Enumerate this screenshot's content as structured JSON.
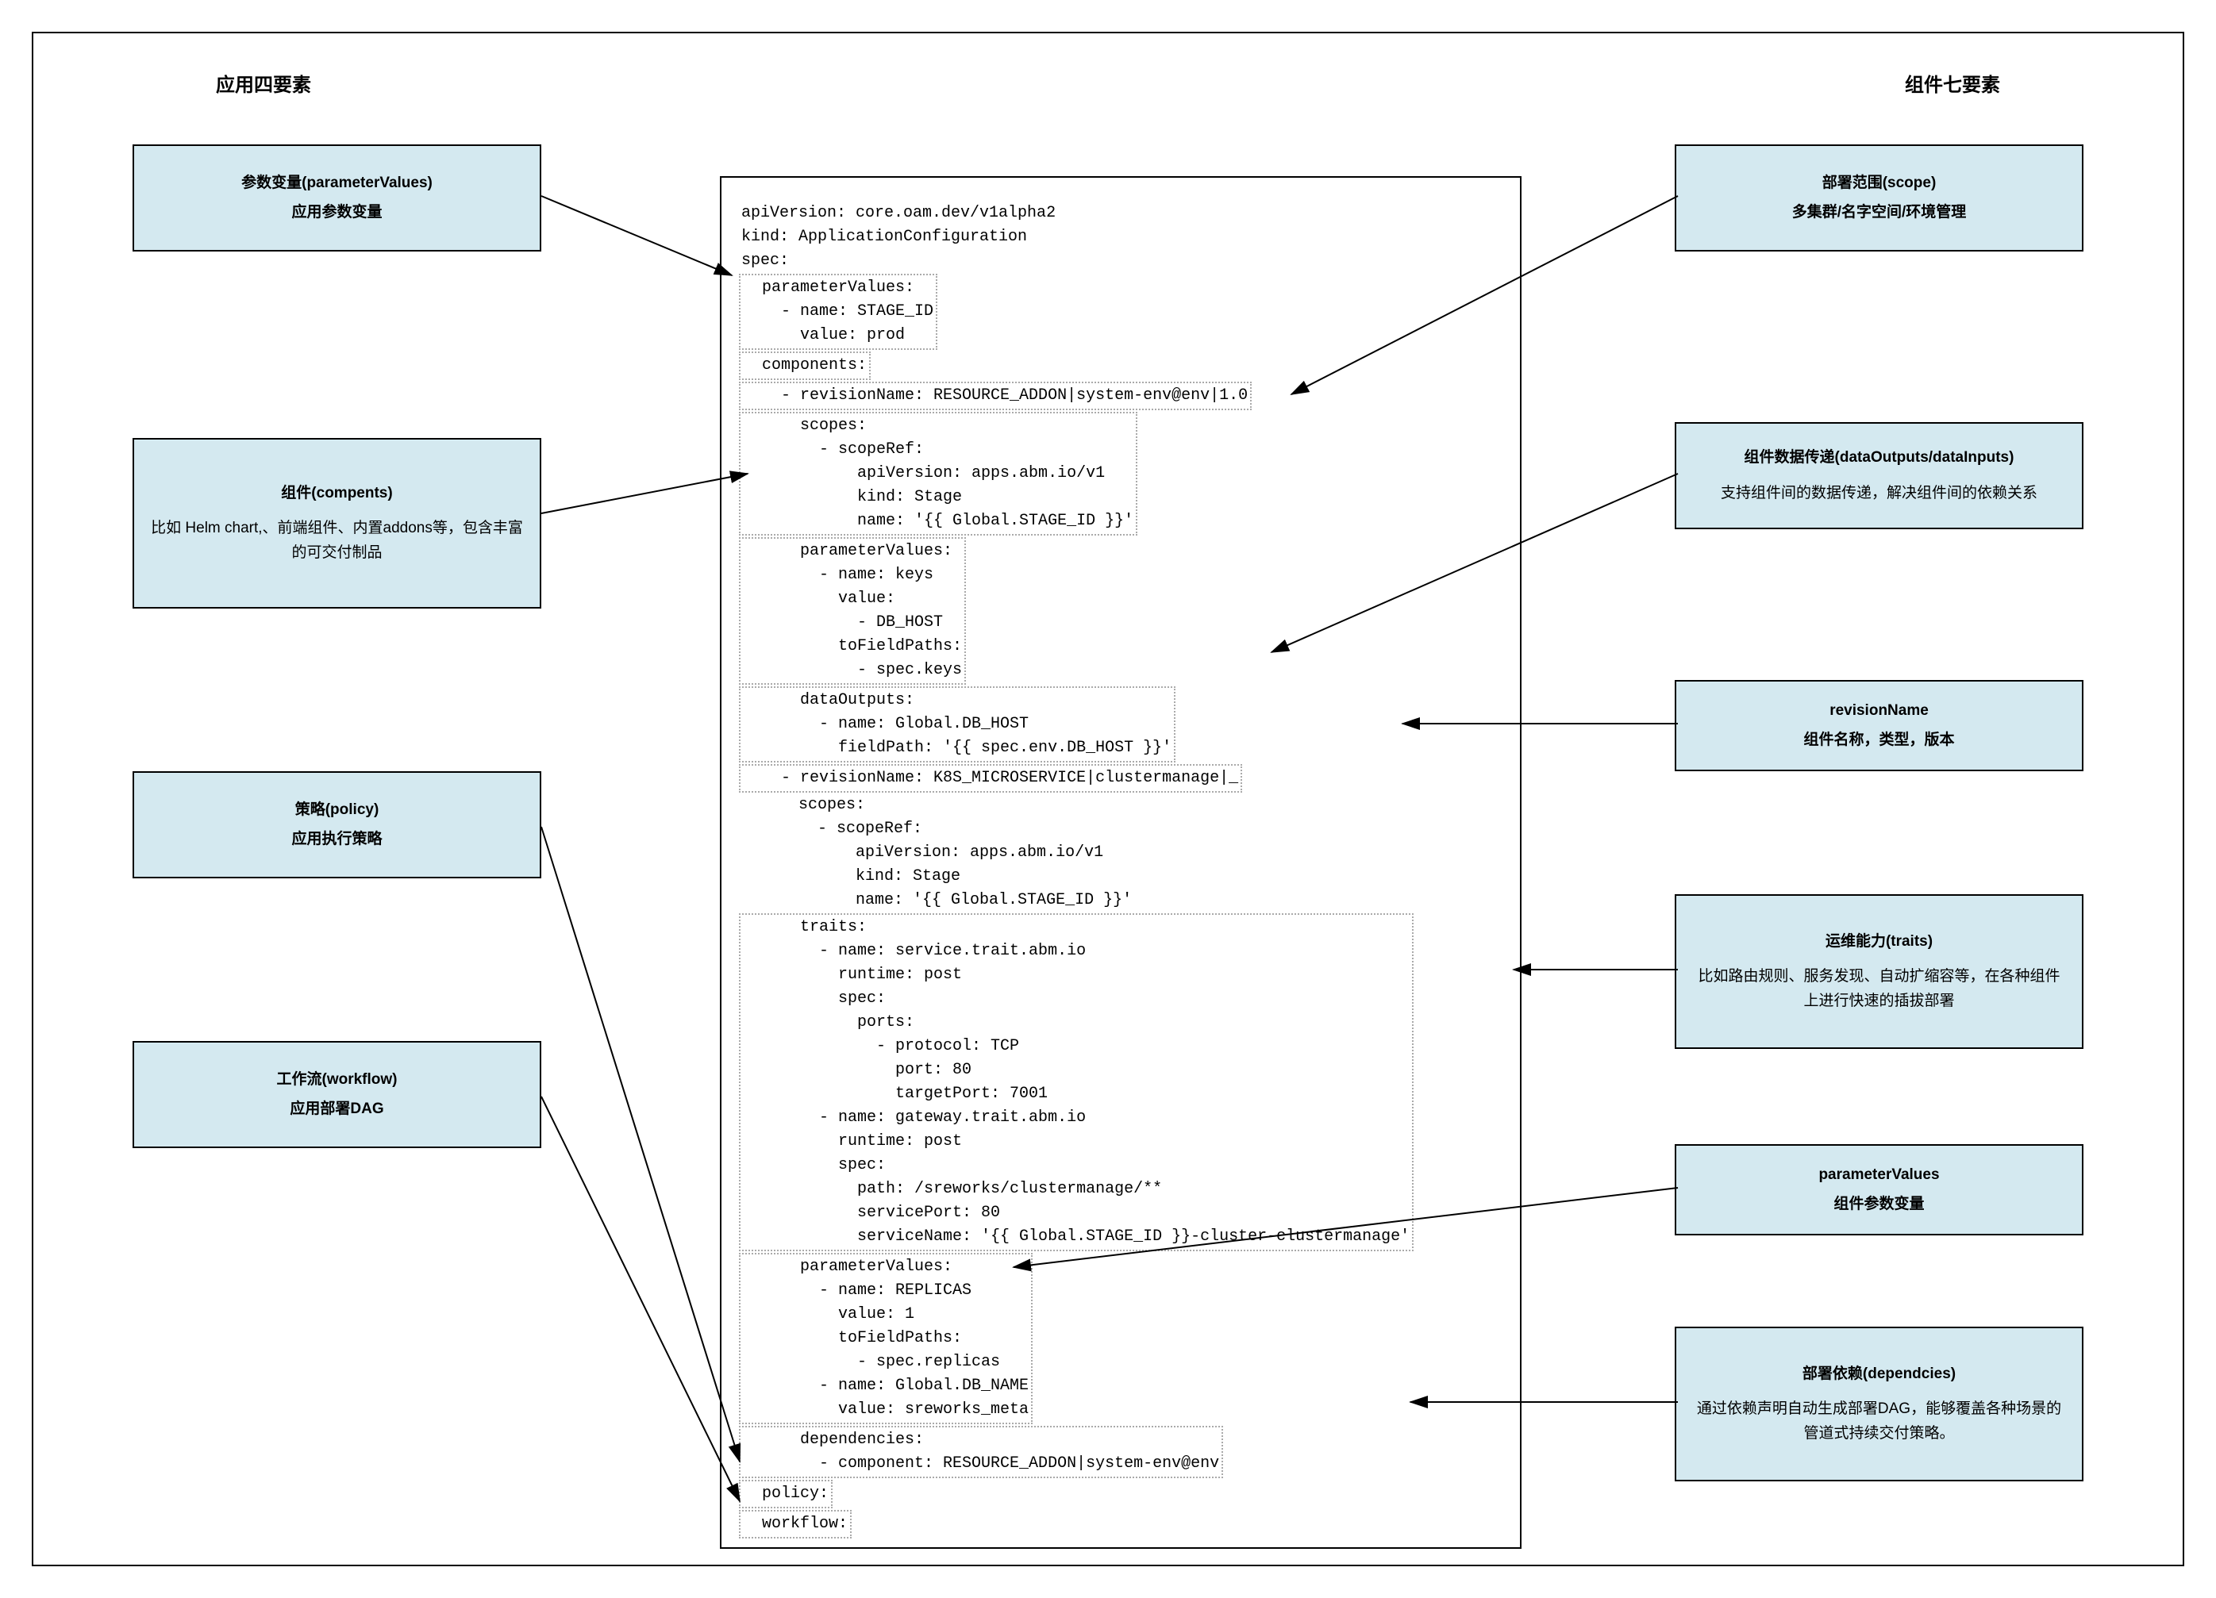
{
  "headings": {
    "left": "应用四要素",
    "right": "组件七要素"
  },
  "left_boxes": {
    "l1": {
      "title": "参数变量(parameterValues)",
      "subtitle": "应用参数变量"
    },
    "l2": {
      "title": "组件(compents)",
      "desc": "比如 Helm chart,、前端组件、内置addons等，包含丰富的可交付制品"
    },
    "l3": {
      "title": "策略(policy)",
      "subtitle": "应用执行策略"
    },
    "l4": {
      "title": "工作流(workflow)",
      "subtitle": "应用部署DAG"
    }
  },
  "right_boxes": {
    "r1": {
      "title": "部署范围(scope)",
      "subtitle": "多集群/名字空间/环境管理"
    },
    "r2": {
      "title": "组件数据传递(dataOutputs/dataInputs)",
      "desc": "支持组件间的数据传递，解决组件间的依赖关系"
    },
    "r3": {
      "title": "revisionName",
      "subtitle": "组件名称，类型，版本"
    },
    "r4": {
      "title": "运维能力(traits)",
      "desc": "比如路由规则、服务发现、自动扩缩容等，在各种组件上进行快速的插拔部署"
    },
    "r5": {
      "title": "parameterValues",
      "subtitle": "组件参数变量"
    },
    "r6": {
      "title": "部署依赖(dependcies)",
      "desc": "通过依赖声明自动生成部署DAG，能够覆盖各种场景的管道式持续交付策略。"
    }
  },
  "yaml": {
    "line1": "apiVersion: core.oam.dev/v1alpha2",
    "line2": "kind: ApplicationConfiguration",
    "line3": "spec:",
    "pv_block": "  parameterValues:\n    - name: STAGE_ID\n      value: prod",
    "components": "  components:",
    "rev1": "    - revisionName: RESOURCE_ADDON|system-env@env|1.0",
    "scopes1": "      scopes:\n        - scopeRef:\n            apiVersion: apps.abm.io/v1\n            kind: Stage\n            name: '{{ Global.STAGE_ID }}'",
    "pv1": "      parameterValues:\n        - name: keys\n          value:\n            - DB_HOST\n          toFieldPaths:\n            - spec.keys",
    "dataout": "      dataOutputs:\n        - name: Global.DB_HOST\n          fieldPath: '{{ spec.env.DB_HOST }}'",
    "rev2": "    - revisionName: K8S_MICROSERVICE|clustermanage|_",
    "scopes2": "      scopes:\n        - scopeRef:\n            apiVersion: apps.abm.io/v1\n            kind: Stage\n            name: '{{ Global.STAGE_ID }}'",
    "traits": "      traits:\n        - name: service.trait.abm.io\n          runtime: post\n          spec:\n            ports:\n              - protocol: TCP\n                port: 80\n                targetPort: 7001\n        - name: gateway.trait.abm.io\n          runtime: post\n          spec:\n            path: /sreworks/clustermanage/**\n            servicePort: 80\n            serviceName: '{{ Global.STAGE_ID }}-cluster-clustermanage'",
    "pv2": "      parameterValues:\n        - name: REPLICAS\n          value: 1\n          toFieldPaths:\n            - spec.replicas\n        - name: Global.DB_NAME\n          value: sreworks_meta",
    "deps": "      dependencies:\n        - component: RESOURCE_ADDON|system-env@env",
    "policy": "  policy:",
    "workflow": "  workflow:"
  }
}
